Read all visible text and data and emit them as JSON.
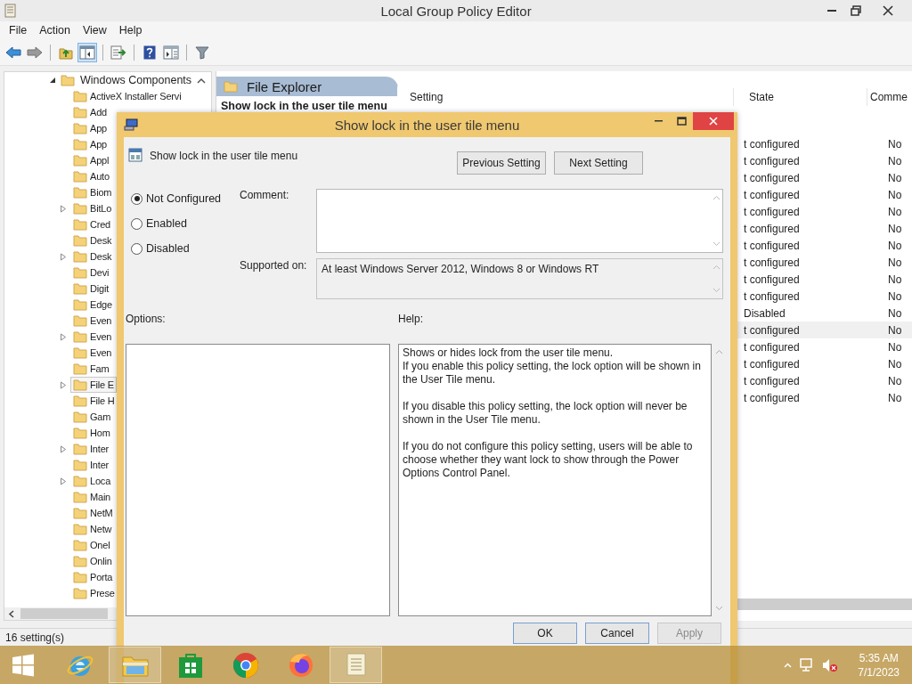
{
  "window": {
    "title": "Local Group Policy Editor"
  },
  "menu": [
    "File",
    "Action",
    "View",
    "Help"
  ],
  "toolbar": [
    {
      "kind": "back",
      "active": false
    },
    {
      "kind": "forward",
      "active": false
    },
    {
      "kind": "up",
      "active": false
    },
    {
      "kind": "tree",
      "active": true
    },
    {
      "kind": "export",
      "active": false
    },
    {
      "kind": "help",
      "active": false
    },
    {
      "kind": "view",
      "active": false
    },
    {
      "kind": "filter",
      "active": false
    }
  ],
  "tree": {
    "label": "Windows Components",
    "expanded": true,
    "children": [
      {
        "label": "ActiveX Installer Servi",
        "has_children": false,
        "selected": false
      },
      {
        "label": "Add",
        "has_children": false,
        "selected": false
      },
      {
        "label": "App",
        "has_children": false,
        "selected": false
      },
      {
        "label": "App",
        "has_children": false,
        "selected": false
      },
      {
        "label": "Appl",
        "has_children": false,
        "selected": false
      },
      {
        "label": "Auto",
        "has_children": false,
        "selected": false
      },
      {
        "label": "Biom",
        "has_children": false,
        "selected": false
      },
      {
        "label": "BitLo",
        "has_children": true,
        "selected": false
      },
      {
        "label": "Cred",
        "has_children": false,
        "selected": false
      },
      {
        "label": "Desk",
        "has_children": false,
        "selected": false
      },
      {
        "label": "Desk",
        "has_children": true,
        "selected": false
      },
      {
        "label": "Devi",
        "has_children": false,
        "selected": false
      },
      {
        "label": "Digit",
        "has_children": false,
        "selected": false
      },
      {
        "label": "Edge",
        "has_children": false,
        "selected": false
      },
      {
        "label": "Even",
        "has_children": false,
        "selected": false
      },
      {
        "label": "Even",
        "has_children": true,
        "selected": false
      },
      {
        "label": "Even",
        "has_children": false,
        "selected": false
      },
      {
        "label": "Fam",
        "has_children": false,
        "selected": false
      },
      {
        "label": "File E",
        "has_children": true,
        "selected": true
      },
      {
        "label": "File H",
        "has_children": false,
        "selected": false
      },
      {
        "label": "Gam",
        "has_children": false,
        "selected": false
      },
      {
        "label": "Hom",
        "has_children": false,
        "selected": false
      },
      {
        "label": "Inter",
        "has_children": true,
        "selected": false
      },
      {
        "label": "Inter",
        "has_children": false,
        "selected": false
      },
      {
        "label": "Loca",
        "has_children": true,
        "selected": false
      },
      {
        "label": "Main",
        "has_children": false,
        "selected": false
      },
      {
        "label": "NetM",
        "has_children": false,
        "selected": false
      },
      {
        "label": "Netw",
        "has_children": false,
        "selected": false
      },
      {
        "label": "Onel",
        "has_children": false,
        "selected": false
      },
      {
        "label": "Onlin",
        "has_children": false,
        "selected": false
      },
      {
        "label": "Porta",
        "has_children": false,
        "selected": false
      },
      {
        "label": "Prese",
        "has_children": false,
        "selected": false
      }
    ]
  },
  "pane": {
    "heading": "File Explorer",
    "selected_setting": "Show lock in the user tile menu",
    "columns": [
      "Setting",
      "State",
      "Comme"
    ],
    "rows": [
      {
        "state": "t configured",
        "comment": "No",
        "selected": false
      },
      {
        "state": "t configured",
        "comment": "No",
        "selected": false
      },
      {
        "state": "t configured",
        "comment": "No",
        "selected": false
      },
      {
        "state": "t configured",
        "comment": "No",
        "selected": false
      },
      {
        "state": "t configured",
        "comment": "No",
        "selected": false
      },
      {
        "state": "t configured",
        "comment": "No",
        "selected": false
      },
      {
        "state": "t configured",
        "comment": "No",
        "selected": false
      },
      {
        "state": "t configured",
        "comment": "No",
        "selected": false
      },
      {
        "state": "t configured",
        "comment": "No",
        "selected": false
      },
      {
        "state": "t configured",
        "comment": "No",
        "selected": false
      },
      {
        "state": "Disabled",
        "comment": "No",
        "selected": false
      },
      {
        "state": "t configured",
        "comment": "No",
        "selected": true
      },
      {
        "state": "t configured",
        "comment": "No",
        "selected": false
      },
      {
        "state": "t configured",
        "comment": "No",
        "selected": false
      },
      {
        "state": "t configured",
        "comment": "No",
        "selected": false
      },
      {
        "state": "t configured",
        "comment": "No",
        "selected": false
      }
    ]
  },
  "status_bar": "16 setting(s)",
  "dialog": {
    "title": "Show lock in the user tile menu",
    "setting_name": "Show lock in the user tile menu",
    "nav_buttons": [
      "Previous Setting",
      "Next Setting"
    ],
    "states": [
      {
        "label": "Not Configured",
        "selected": true
      },
      {
        "label": "Enabled",
        "selected": false
      },
      {
        "label": "Disabled",
        "selected": false
      }
    ],
    "comment_label": "Comment:",
    "supported_label": "Supported on:",
    "supported_text": "At least Windows Server 2012, Windows 8 or Windows RT",
    "options_label": "Options:",
    "help_label": "Help:",
    "help_text": "Shows or hides lock from the user tile menu.\nIf you enable this policy setting, the lock option will be shown in the User Tile menu.\n\nIf you disable this policy setting, the lock option will never be shown in the User Tile menu.\n\nIf you do not configure this policy setting, users will be able to choose whether they want lock to show through the Power Options Control Panel.",
    "footer_buttons": [
      {
        "label": "OK",
        "disabled": false
      },
      {
        "label": "Cancel",
        "disabled": false
      },
      {
        "label": "Apply",
        "disabled": true
      }
    ]
  },
  "taskbar": {
    "apps": [
      {
        "kind": "ie",
        "active": false
      },
      {
        "kind": "explorer",
        "active": true
      },
      {
        "kind": "store",
        "active": false
      },
      {
        "kind": "chrome",
        "active": false
      },
      {
        "kind": "firefox",
        "active": false
      },
      {
        "kind": "notepad",
        "active": true
      }
    ],
    "time": "5:35 AM",
    "date": "7/1/2023"
  }
}
